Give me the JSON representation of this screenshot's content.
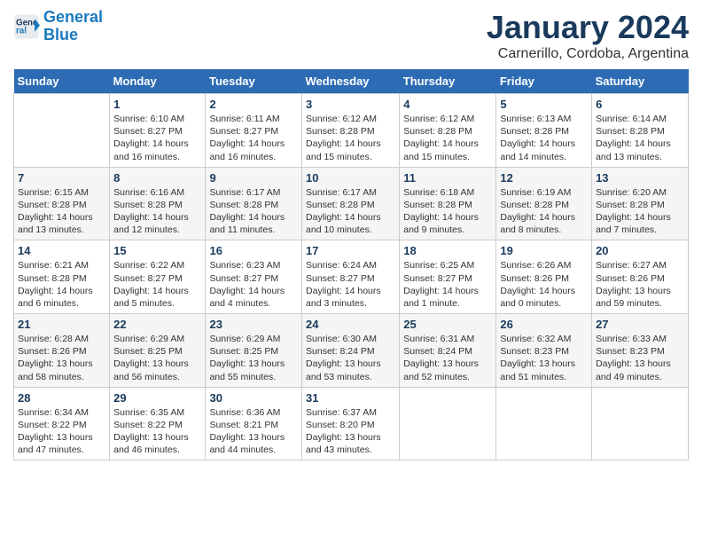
{
  "logo": {
    "line1": "General",
    "line2": "Blue"
  },
  "title": "January 2024",
  "subtitle": "Carnerillo, Cordoba, Argentina",
  "weekdays": [
    "Sunday",
    "Monday",
    "Tuesday",
    "Wednesday",
    "Thursday",
    "Friday",
    "Saturday"
  ],
  "weeks": [
    [
      {
        "day": "",
        "info": ""
      },
      {
        "day": "1",
        "info": "Sunrise: 6:10 AM\nSunset: 8:27 PM\nDaylight: 14 hours\nand 16 minutes."
      },
      {
        "day": "2",
        "info": "Sunrise: 6:11 AM\nSunset: 8:27 PM\nDaylight: 14 hours\nand 16 minutes."
      },
      {
        "day": "3",
        "info": "Sunrise: 6:12 AM\nSunset: 8:28 PM\nDaylight: 14 hours\nand 15 minutes."
      },
      {
        "day": "4",
        "info": "Sunrise: 6:12 AM\nSunset: 8:28 PM\nDaylight: 14 hours\nand 15 minutes."
      },
      {
        "day": "5",
        "info": "Sunrise: 6:13 AM\nSunset: 8:28 PM\nDaylight: 14 hours\nand 14 minutes."
      },
      {
        "day": "6",
        "info": "Sunrise: 6:14 AM\nSunset: 8:28 PM\nDaylight: 14 hours\nand 13 minutes."
      }
    ],
    [
      {
        "day": "7",
        "info": "Sunrise: 6:15 AM\nSunset: 8:28 PM\nDaylight: 14 hours\nand 13 minutes."
      },
      {
        "day": "8",
        "info": "Sunrise: 6:16 AM\nSunset: 8:28 PM\nDaylight: 14 hours\nand 12 minutes."
      },
      {
        "day": "9",
        "info": "Sunrise: 6:17 AM\nSunset: 8:28 PM\nDaylight: 14 hours\nand 11 minutes."
      },
      {
        "day": "10",
        "info": "Sunrise: 6:17 AM\nSunset: 8:28 PM\nDaylight: 14 hours\nand 10 minutes."
      },
      {
        "day": "11",
        "info": "Sunrise: 6:18 AM\nSunset: 8:28 PM\nDaylight: 14 hours\nand 9 minutes."
      },
      {
        "day": "12",
        "info": "Sunrise: 6:19 AM\nSunset: 8:28 PM\nDaylight: 14 hours\nand 8 minutes."
      },
      {
        "day": "13",
        "info": "Sunrise: 6:20 AM\nSunset: 8:28 PM\nDaylight: 14 hours\nand 7 minutes."
      }
    ],
    [
      {
        "day": "14",
        "info": "Sunrise: 6:21 AM\nSunset: 8:28 PM\nDaylight: 14 hours\nand 6 minutes."
      },
      {
        "day": "15",
        "info": "Sunrise: 6:22 AM\nSunset: 8:27 PM\nDaylight: 14 hours\nand 5 minutes."
      },
      {
        "day": "16",
        "info": "Sunrise: 6:23 AM\nSunset: 8:27 PM\nDaylight: 14 hours\nand 4 minutes."
      },
      {
        "day": "17",
        "info": "Sunrise: 6:24 AM\nSunset: 8:27 PM\nDaylight: 14 hours\nand 3 minutes."
      },
      {
        "day": "18",
        "info": "Sunrise: 6:25 AM\nSunset: 8:27 PM\nDaylight: 14 hours\nand 1 minute."
      },
      {
        "day": "19",
        "info": "Sunrise: 6:26 AM\nSunset: 8:26 PM\nDaylight: 14 hours\nand 0 minutes."
      },
      {
        "day": "20",
        "info": "Sunrise: 6:27 AM\nSunset: 8:26 PM\nDaylight: 13 hours\nand 59 minutes."
      }
    ],
    [
      {
        "day": "21",
        "info": "Sunrise: 6:28 AM\nSunset: 8:26 PM\nDaylight: 13 hours\nand 58 minutes."
      },
      {
        "day": "22",
        "info": "Sunrise: 6:29 AM\nSunset: 8:25 PM\nDaylight: 13 hours\nand 56 minutes."
      },
      {
        "day": "23",
        "info": "Sunrise: 6:29 AM\nSunset: 8:25 PM\nDaylight: 13 hours\nand 55 minutes."
      },
      {
        "day": "24",
        "info": "Sunrise: 6:30 AM\nSunset: 8:24 PM\nDaylight: 13 hours\nand 53 minutes."
      },
      {
        "day": "25",
        "info": "Sunrise: 6:31 AM\nSunset: 8:24 PM\nDaylight: 13 hours\nand 52 minutes."
      },
      {
        "day": "26",
        "info": "Sunrise: 6:32 AM\nSunset: 8:23 PM\nDaylight: 13 hours\nand 51 minutes."
      },
      {
        "day": "27",
        "info": "Sunrise: 6:33 AM\nSunset: 8:23 PM\nDaylight: 13 hours\nand 49 minutes."
      }
    ],
    [
      {
        "day": "28",
        "info": "Sunrise: 6:34 AM\nSunset: 8:22 PM\nDaylight: 13 hours\nand 47 minutes."
      },
      {
        "day": "29",
        "info": "Sunrise: 6:35 AM\nSunset: 8:22 PM\nDaylight: 13 hours\nand 46 minutes."
      },
      {
        "day": "30",
        "info": "Sunrise: 6:36 AM\nSunset: 8:21 PM\nDaylight: 13 hours\nand 44 minutes."
      },
      {
        "day": "31",
        "info": "Sunrise: 6:37 AM\nSunset: 8:20 PM\nDaylight: 13 hours\nand 43 minutes."
      },
      {
        "day": "",
        "info": ""
      },
      {
        "day": "",
        "info": ""
      },
      {
        "day": "",
        "info": ""
      }
    ]
  ]
}
